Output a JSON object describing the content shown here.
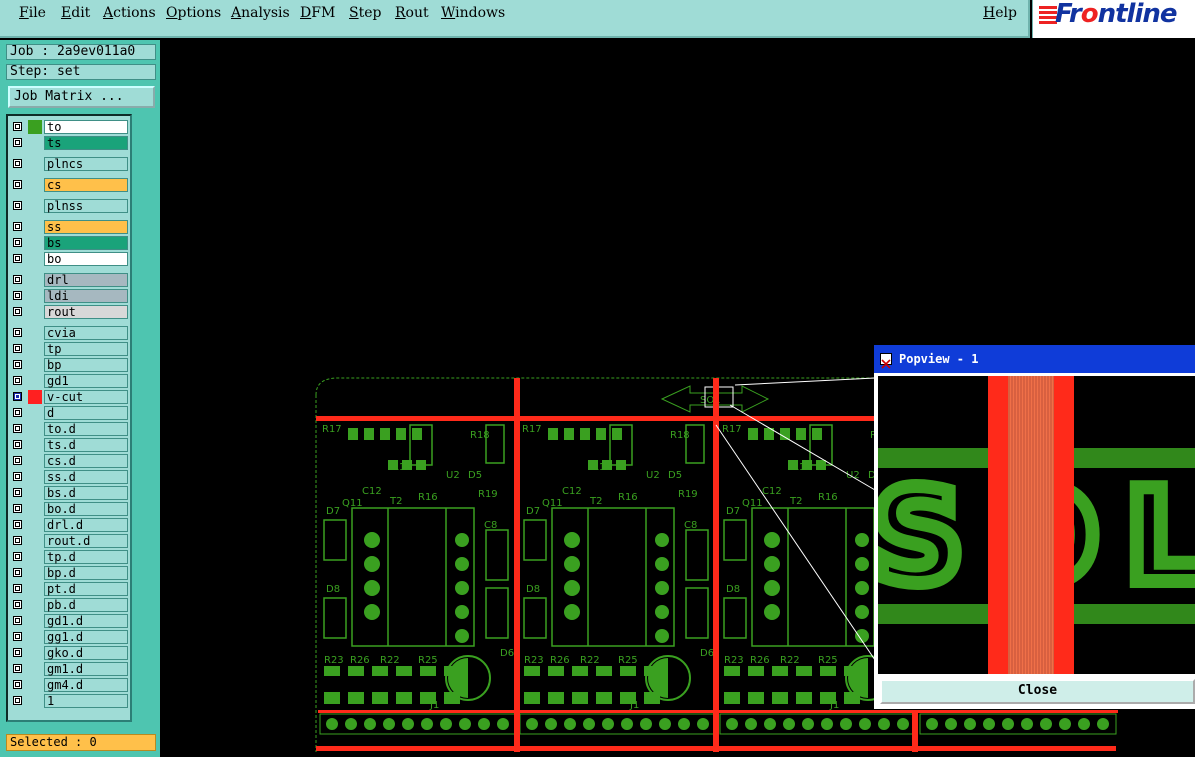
{
  "menu": {
    "items": [
      "File",
      "Edit",
      "Actions",
      "Options",
      "Analysis",
      "DFM",
      "Step",
      "Rout",
      "Windows"
    ],
    "help": "Help"
  },
  "logo": {
    "prefix": "Fr",
    "o_letter": "o",
    "suffix": "ntline"
  },
  "job": {
    "job_label": "Job : 2a9ev011a0",
    "step_label": "Step: set",
    "matrix_button": "Job Matrix ..."
  },
  "layers": [
    {
      "name": "to",
      "color": "#ffffff",
      "swatch": "#3aa020",
      "checked": false
    },
    {
      "name": "ts",
      "color": "#1aa37a",
      "swatch": "",
      "checked": false
    },
    {
      "name": "plncs",
      "color": "#9fdcd6",
      "swatch": "",
      "checked": false
    },
    {
      "name": "cs",
      "color": "#ffc04a",
      "swatch": "",
      "checked": false
    },
    {
      "name": "plnss",
      "color": "#9fdcd6",
      "swatch": "",
      "checked": false
    },
    {
      "name": "ss",
      "color": "#ffc04a",
      "swatch": "",
      "checked": false
    },
    {
      "name": "bs",
      "color": "#1aa37a",
      "swatch": "",
      "checked": false
    },
    {
      "name": "bo",
      "color": "#ffffff",
      "swatch": "",
      "checked": false
    },
    {
      "name": "drl",
      "color": "#a6b8c0",
      "swatch": "",
      "checked": false
    },
    {
      "name": "ldi",
      "color": "#a6b8c0",
      "swatch": "",
      "checked": false
    },
    {
      "name": "rout",
      "color": "#d8d8d8",
      "swatch": "",
      "checked": false
    },
    {
      "name": "cvia",
      "color": "#9fdcd6",
      "swatch": "",
      "checked": false
    },
    {
      "name": "tp",
      "color": "#9fdcd6",
      "swatch": "",
      "checked": false
    },
    {
      "name": "bp",
      "color": "#9fdcd6",
      "swatch": "",
      "checked": false
    },
    {
      "name": "gd1",
      "color": "#9fdcd6",
      "swatch": "",
      "checked": false
    },
    {
      "name": "v-cut",
      "color": "#9fdcd6",
      "swatch": "#ff2020",
      "checked": true
    },
    {
      "name": "d",
      "color": "#9fdcd6",
      "swatch": "",
      "checked": false
    },
    {
      "name": "to.d",
      "color": "#9fdcd6",
      "swatch": "",
      "checked": false
    },
    {
      "name": "ts.d",
      "color": "#9fdcd6",
      "swatch": "",
      "checked": false
    },
    {
      "name": "cs.d",
      "color": "#9fdcd6",
      "swatch": "",
      "checked": false
    },
    {
      "name": "ss.d",
      "color": "#9fdcd6",
      "swatch": "",
      "checked": false
    },
    {
      "name": "bs.d",
      "color": "#9fdcd6",
      "swatch": "",
      "checked": false
    },
    {
      "name": "bo.d",
      "color": "#9fdcd6",
      "swatch": "",
      "checked": false
    },
    {
      "name": "drl.d",
      "color": "#9fdcd6",
      "swatch": "",
      "checked": false
    },
    {
      "name": "rout.d",
      "color": "#9fdcd6",
      "swatch": "",
      "checked": false
    },
    {
      "name": "tp.d",
      "color": "#9fdcd6",
      "swatch": "",
      "checked": false
    },
    {
      "name": "bp.d",
      "color": "#9fdcd6",
      "swatch": "",
      "checked": false
    },
    {
      "name": "pt.d",
      "color": "#9fdcd6",
      "swatch": "",
      "checked": false
    },
    {
      "name": "pb.d",
      "color": "#9fdcd6",
      "swatch": "",
      "checked": false
    },
    {
      "name": "gd1.d",
      "color": "#9fdcd6",
      "swatch": "",
      "checked": false
    },
    {
      "name": "gg1.d",
      "color": "#9fdcd6",
      "swatch": "",
      "checked": false
    },
    {
      "name": "gko.d",
      "color": "#9fdcd6",
      "swatch": "",
      "checked": false
    },
    {
      "name": "gm1.d",
      "color": "#9fdcd6",
      "swatch": "",
      "checked": false
    },
    {
      "name": "gm4.d",
      "color": "#9fdcd6",
      "swatch": "",
      "checked": false
    },
    {
      "name": "1",
      "color": "#9fdcd6",
      "swatch": "",
      "checked": false
    }
  ],
  "status": {
    "selected": "Selected : 0"
  },
  "pcb": {
    "board_label": "SOL",
    "refs": [
      "R17",
      "R18",
      "R19",
      "R16",
      "R13",
      "U2",
      "D5",
      "C12",
      "T2",
      "Q11",
      "D7",
      "D8",
      "C8",
      "D6",
      "R23",
      "R26",
      "R22",
      "R25",
      "J1"
    ]
  },
  "popview": {
    "title": "Popview - 1",
    "zoom_text": "SOL",
    "close_label": "Close"
  },
  "colors": {
    "accent_panel": "#4ec5b0",
    "trace": "#3aa020",
    "vcut": "#ff2a1a",
    "popview_title": "#0f3cd8"
  }
}
